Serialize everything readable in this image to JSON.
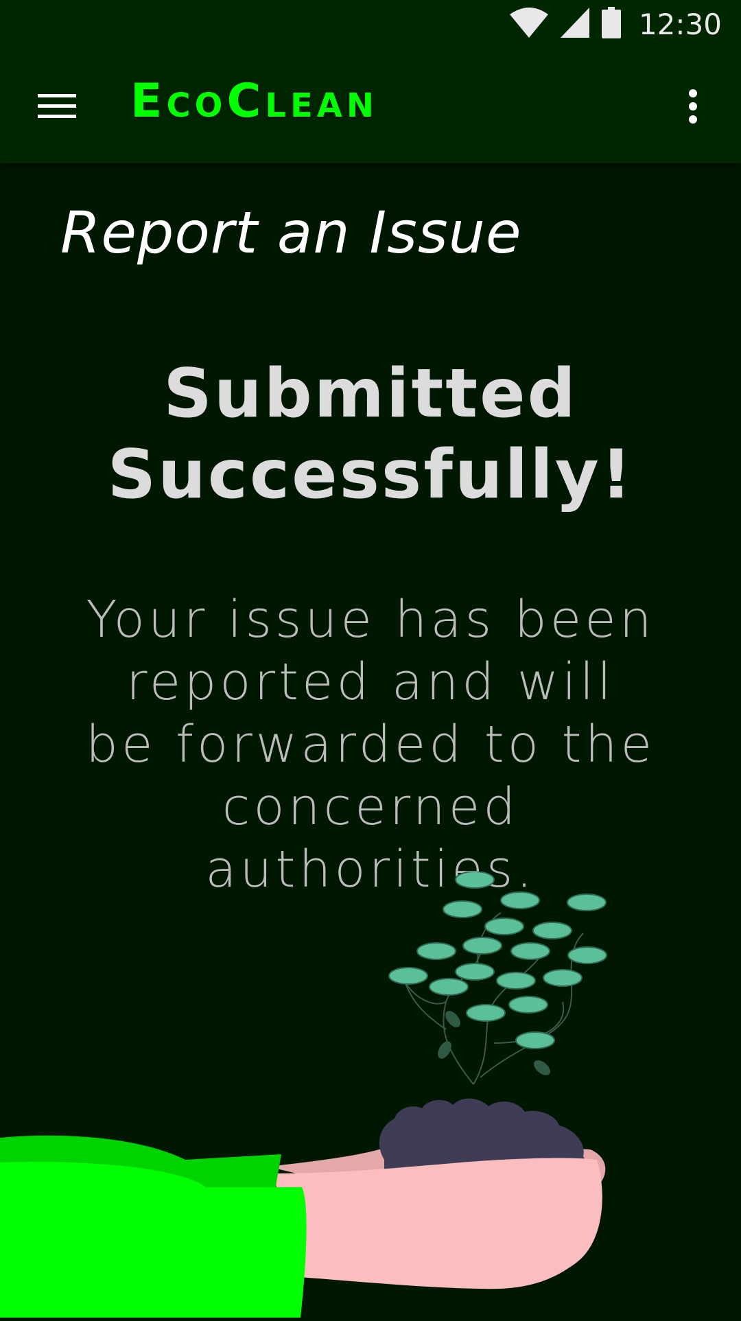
{
  "status_bar": {
    "time": "12:30",
    "icons": [
      "wifi-icon",
      "cellular-signal-icon",
      "battery-icon"
    ]
  },
  "app_bar": {
    "title": "EcoClean",
    "menu_icon": "hamburger-menu-icon",
    "overflow_icon": "more-vert-icon"
  },
  "page": {
    "title": "Report an Issue",
    "heading": "Submitted Successfully!",
    "message": "Your issue has been reported and will be forwarded to the concerned authorities."
  },
  "illustration": {
    "name": "hand-holding-plant-illustration"
  },
  "colors": {
    "accent": "#00ff00",
    "background": "#001702",
    "app_bar": "#002600",
    "leaf": "#5bbf98",
    "soil": "#3f3d56",
    "skin": "#fbbebe"
  }
}
